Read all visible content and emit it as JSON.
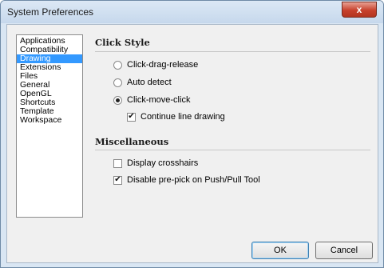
{
  "window": {
    "title": "System Preferences",
    "close_glyph": "x"
  },
  "sidebar": {
    "items": [
      {
        "label": "Applications",
        "selected": false
      },
      {
        "label": "Compatibility",
        "selected": false
      },
      {
        "label": "Drawing",
        "selected": true
      },
      {
        "label": "Extensions",
        "selected": false
      },
      {
        "label": "Files",
        "selected": false
      },
      {
        "label": "General",
        "selected": false
      },
      {
        "label": "OpenGL",
        "selected": false
      },
      {
        "label": "Shortcuts",
        "selected": false
      },
      {
        "label": "Template",
        "selected": false
      },
      {
        "label": "Workspace",
        "selected": false
      }
    ]
  },
  "click_style": {
    "title": "Click Style",
    "options": [
      {
        "label": "Click-drag-release",
        "checked": false
      },
      {
        "label": "Auto detect",
        "checked": false
      },
      {
        "label": "Click-move-click",
        "checked": true
      }
    ],
    "continue_line": {
      "label": "Continue line drawing",
      "checked": true
    }
  },
  "misc": {
    "title": "Miscellaneous",
    "display_crosshairs": {
      "label": "Display crosshairs",
      "checked": false
    },
    "disable_prepick": {
      "label": "Disable pre-pick on Push/Pull Tool",
      "checked": true
    }
  },
  "buttons": {
    "ok": "OK",
    "cancel": "Cancel"
  },
  "colors": {
    "selection": "#3399ff",
    "close_button": "#c7412c"
  }
}
